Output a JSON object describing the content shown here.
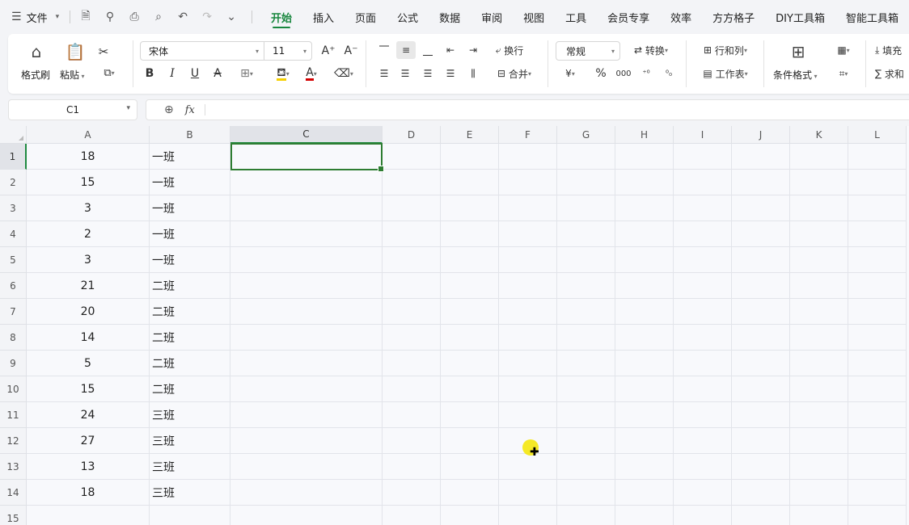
{
  "menu": {
    "file_label": "文件",
    "tabs": [
      "开始",
      "插入",
      "页面",
      "公式",
      "数据",
      "审阅",
      "视图",
      "工具",
      "会员专享",
      "效率",
      "方方格子",
      "DIY工具箱",
      "智能工具箱"
    ],
    "active_tab": "开始"
  },
  "ribbon": {
    "format_painter": "格式刷",
    "paste": "粘贴",
    "font_name": "宋体",
    "font_size": "11",
    "wrap": "换行",
    "merge": "合并",
    "number_format": "常规",
    "convert": "转换",
    "rows_cols": "行和列",
    "worksheet": "工作表",
    "cond_format": "条件格式",
    "fill": "填充",
    "sum": "求和",
    "font_color": "#d40000",
    "fill_color": "#f5d000"
  },
  "formula_bar": {
    "name_box": "C1",
    "fx_label": "fx",
    "content": ""
  },
  "sheet": {
    "columns": [
      "A",
      "B",
      "C",
      "D",
      "E",
      "F",
      "G",
      "H",
      "I",
      "J",
      "K",
      "L"
    ],
    "selected_column": "C",
    "selected_row": "1",
    "row_numbers": [
      "1",
      "2",
      "3",
      "4",
      "5",
      "6",
      "7",
      "8",
      "9",
      "10",
      "11",
      "12",
      "13",
      "14",
      "15"
    ],
    "rows": [
      {
        "a": "18",
        "b": "一班"
      },
      {
        "a": "15",
        "b": "一班"
      },
      {
        "a": "3",
        "b": "一班"
      },
      {
        "a": "2",
        "b": "一班"
      },
      {
        "a": "3",
        "b": "一班"
      },
      {
        "a": "21",
        "b": "二班"
      },
      {
        "a": "20",
        "b": "二班"
      },
      {
        "a": "14",
        "b": "二班"
      },
      {
        "a": "5",
        "b": "二班"
      },
      {
        "a": "15",
        "b": "二班"
      },
      {
        "a": "24",
        "b": "三班"
      },
      {
        "a": "27",
        "b": "三班"
      },
      {
        "a": "13",
        "b": "三班"
      },
      {
        "a": "18",
        "b": "三班"
      },
      {
        "a": "",
        "b": ""
      }
    ]
  }
}
